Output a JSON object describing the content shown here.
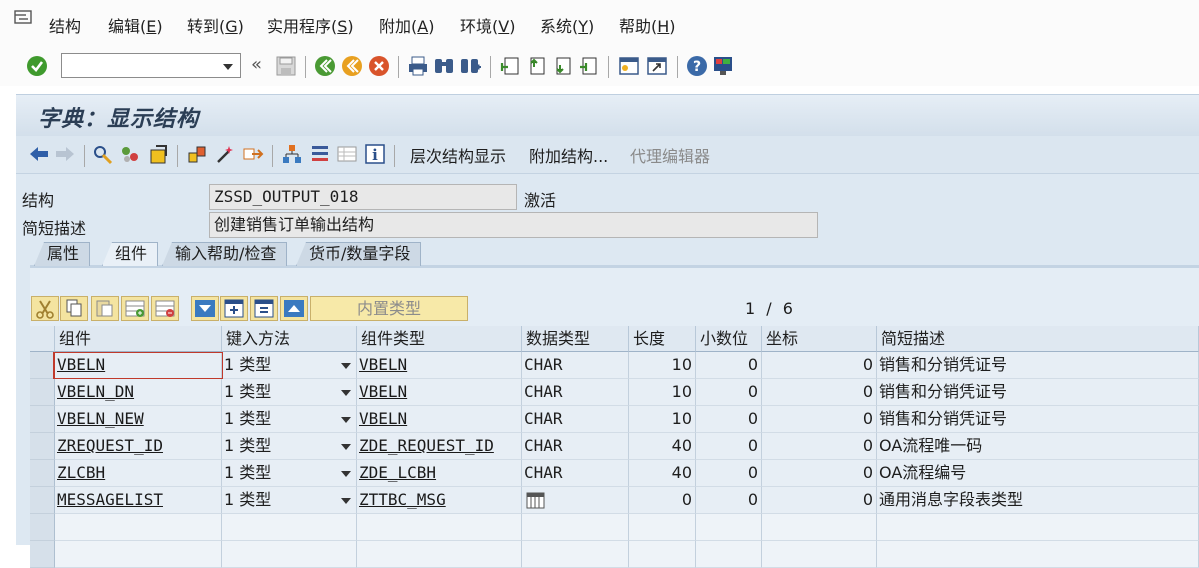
{
  "menu": {
    "items": [
      {
        "label": "结构"
      },
      {
        "label": "编辑",
        "key": "E"
      },
      {
        "label": "转到",
        "key": "G"
      },
      {
        "label": "实用程序",
        "key": "S"
      },
      {
        "label": "附加",
        "key": "A"
      },
      {
        "label": "环境",
        "key": "V"
      },
      {
        "label": "系统",
        "key": "Y"
      },
      {
        "label": "帮助",
        "key": "H"
      }
    ]
  },
  "command_field": {
    "value": "",
    "placeholder": ""
  },
  "title": "字典：显示结构",
  "app_toolbar": {
    "hierarchy_display": "层次结构显示",
    "append_structure": "附加结构...",
    "proxy_editor": "代理编辑器"
  },
  "header": {
    "structure_label": "结构",
    "structure_value": "ZSSD_OUTPUT_018",
    "status": "激活",
    "short_desc_label": "简短描述",
    "short_desc_value": "创建销售订单输出结构"
  },
  "tabs": [
    {
      "label": "属性",
      "active": false
    },
    {
      "label": "组件",
      "active": true
    },
    {
      "label": "输入帮助/检查",
      "active": false
    },
    {
      "label": "货币/数量字段",
      "active": false
    }
  ],
  "table_toolbar": {
    "builtin_type": "内置类型",
    "page_current": "1",
    "page_sep": "/",
    "page_total": "6"
  },
  "table": {
    "columns": [
      "组件",
      "键入方法",
      "组件类型",
      "数据类型",
      "长度",
      "小数位",
      "坐标",
      "简短描述"
    ],
    "rows": [
      {
        "component": "VBELN",
        "typing": "1 类型",
        "comp_type": "VBELN",
        "data_type": "CHAR",
        "length": "10",
        "decimals": "0",
        "coord": "0",
        "desc": "销售和分销凭证号"
      },
      {
        "component": "VBELN_DN",
        "typing": "1 类型",
        "comp_type": "VBELN",
        "data_type": "CHAR",
        "length": "10",
        "decimals": "0",
        "coord": "0",
        "desc": "销售和分销凭证号"
      },
      {
        "component": "VBELN_NEW",
        "typing": "1 类型",
        "comp_type": "VBELN",
        "data_type": "CHAR",
        "length": "10",
        "decimals": "0",
        "coord": "0",
        "desc": "销售和分销凭证号"
      },
      {
        "component": "ZREQUEST_ID",
        "typing": "1 类型",
        "comp_type": "ZDE_REQUEST_ID",
        "data_type": "CHAR",
        "length": "40",
        "decimals": "0",
        "coord": "0",
        "desc": "OA流程唯一码"
      },
      {
        "component": "ZLCBH",
        "typing": "1 类型",
        "comp_type": "ZDE_LCBH",
        "data_type": "CHAR",
        "length": "40",
        "decimals": "0",
        "coord": "0",
        "desc": "OA流程编号"
      },
      {
        "component": "MESSAGELIST",
        "typing": "1 类型",
        "comp_type": "ZTTBC_MSG",
        "data_type": "",
        "data_type_icon": "table-type-icon",
        "length": "0",
        "decimals": "0",
        "coord": "0",
        "desc": "通用消息字段表类型"
      }
    ]
  },
  "colors": {
    "title_bar": "#d3dfeb",
    "panel": "#dde8f2",
    "cell": "#e7eef5",
    "header": "#dfe8f1",
    "button": "#f4e4a0",
    "ok_green": "#3f9a2d"
  }
}
